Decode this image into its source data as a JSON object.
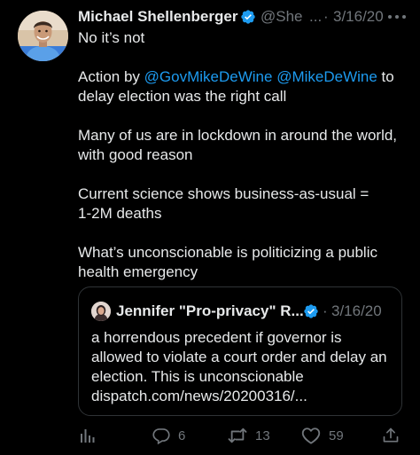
{
  "tweet": {
    "author_name": "Michael Shellenberger",
    "handle": "@She",
    "handle_ellipsis": "...",
    "separator": "·",
    "timestamp": "3/16/20",
    "avatar_icon": "person-photo-icon",
    "verified_icon": "verified-badge-icon",
    "more_icon": "more-dots-icon",
    "text": {
      "line1": "No it’s not",
      "p2_prefix": "Action by ",
      "mention1": "@GovMikeDeWine",
      "mention2": "@MikeDeWine",
      "p2_suffix_line1": " to",
      "p2_line2": "delay election was the right call",
      "p3_line1": "Many of us are in lockdown in around the world,",
      "p3_line2": "with good reason",
      "p4_line1": "Current science shows business-as-usual =",
      "p4_line2": "1-2M deaths",
      "p5_line1": "What’s unconscionable is politicizing a public",
      "p5_line2": "health emergency"
    }
  },
  "quote": {
    "author_name": "Jennifer \"Pro-privacy\" R...",
    "separator": "·",
    "timestamp": "3/16/20",
    "avatar_icon": "person-photo-icon",
    "verified_icon": "verified-badge-icon",
    "lines": [
      "a horrendous precedent if governor is",
      "allowed to violate a court order and delay an",
      "election. This is unconscionable",
      "dispatch.com/news/20200316/..."
    ]
  },
  "actions": {
    "analytics_icon": "analytics-bars-icon",
    "reply_icon": "reply-bubble-icon",
    "reply_count": "6",
    "retweet_icon": "retweet-icon",
    "retweet_count": "13",
    "like_icon": "heart-icon",
    "like_count": "59",
    "share_icon": "share-icon"
  },
  "colors": {
    "background": "#000000",
    "text": "#e7e9ea",
    "secondary": "#71767b",
    "link": "#1d9bf0",
    "border": "#2f3336"
  }
}
